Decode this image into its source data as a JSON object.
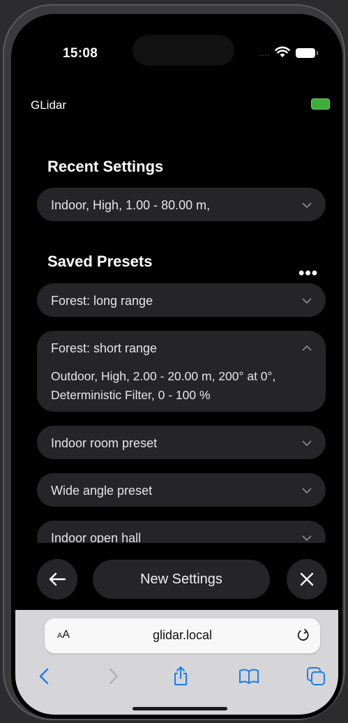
{
  "status_bar": {
    "time": "15:08",
    "dots": "....",
    "battery_icon": "battery-icon",
    "wifi_icon": "wifi-icon"
  },
  "app": {
    "title": "GLidar",
    "status_color": "#3dae3a"
  },
  "recent": {
    "heading": "Recent Settings",
    "current": "Indoor, High, 1.00 - 80.00 m,"
  },
  "presets": {
    "heading": "Saved Presets",
    "more_label": "•••",
    "items": [
      {
        "label": "Forest: long range",
        "expanded": false
      },
      {
        "label": "Forest: short range",
        "expanded": true,
        "detail": "Outdoor, High, 2.00 - 20.00 m, 200° at 0°, Deterministic Filter, 0 - 100 %"
      },
      {
        "label": "Indoor room preset",
        "expanded": false
      },
      {
        "label": "Wide angle preset",
        "expanded": false
      },
      {
        "label": "Indoor open hall",
        "expanded": false
      }
    ]
  },
  "actions": {
    "new_settings": "New Settings",
    "back_icon": "arrow-left-icon",
    "close_icon": "close-icon"
  },
  "safari": {
    "aa_small": "A",
    "aa_large": "A",
    "url": "glidar.local",
    "toolbar_icons": [
      "back-icon",
      "forward-icon",
      "share-icon",
      "bookmarks-icon",
      "tabs-icon"
    ]
  },
  "colors": {
    "accent": "#1a7cf5",
    "pill": "#252527",
    "background": "#000000"
  }
}
